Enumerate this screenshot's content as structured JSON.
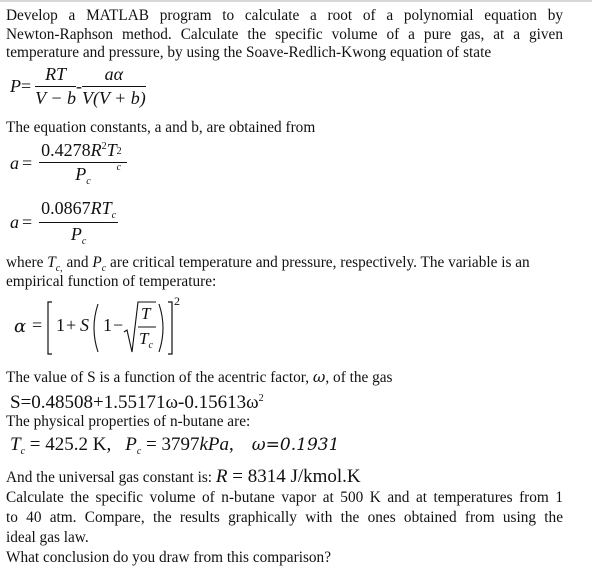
{
  "document": {
    "intro_lines": [
      "Develop a MATLAB program to calculate a root of a polynomial equation by",
      "Newton-Raphson method. Calculate the specific volume of a pure gas, at a given",
      "temperature and pressure, by using the Soave-Redlich-Kwong equation of state"
    ],
    "srk_equation": {
      "lhs": "P",
      "eq": "=",
      "term1_num": "RT",
      "term1_den": "V − b",
      "minus": "-",
      "term2_num": "aα",
      "term2_den": "V(V + b)"
    },
    "constants_intro": "The equation constants, a and b, are obtained from",
    "eq_a": {
      "lhs": "a",
      "eq": "=",
      "num_coef": "0.4278",
      "num_R": "R",
      "num_R_exp": "2",
      "num_T": "T",
      "num_T_sub": "c",
      "num_T_exp": "2",
      "den": "P",
      "den_sub": "c"
    },
    "eq_b": {
      "lhs": "a",
      "eq": "=",
      "num_coef": "0.0867",
      "num_RT": "RT",
      "num_sub": "c",
      "den": "P",
      "den_sub": "c"
    },
    "where_line1": {
      "pre": "where ",
      "tc": "T",
      "tc_sub": "c,",
      "mid": " and ",
      "pc": "P",
      "pc_sub": "c",
      "post": " are critical temperature and pressure, respectively. The variable is an"
    },
    "where_line2": "empirical function of temperature:",
    "alpha_equation": {
      "lhs": "α",
      "eq": "=",
      "one": "1",
      "plus": "+",
      "S": "S",
      "one2": "1",
      "minus": "−",
      "T": "T",
      "Tc": "T",
      "Tc_sub": "c",
      "exp": "2"
    },
    "s_intro_pre": "The value of S is a function of the acentric factor, ",
    "s_intro_omega": "ω",
    "s_intro_post": ", of the gas",
    "s_equation": {
      "text": "S=0.48508+1.55171ω-0.15613ω",
      "exp": "2"
    },
    "properties_intro": "The physical properties of n-butane are:",
    "properties": {
      "tc_sym": "T",
      "tc_sub": "c",
      "tc_val": " = 425.2 K,",
      "pc_sym": "P",
      "pc_sub": "c",
      "pc_val": " = 3797",
      "pc_unit": "kPa",
      "pc_comma": ",",
      "omega": "ω=0.1931"
    },
    "gas_constant": {
      "pre": "And the universal gas constant is: ",
      "sym": "R",
      "val": " = 8314 J/kmol.K"
    },
    "task_lines": [
      "Calculate the specific volume of n-butane vapor at 500 K and at temperatures from 1",
      "to 40 atm. Compare, the results graphically with the ones obtained from using the",
      "ideal gas law."
    ],
    "question": "What conclusion do you draw from this comparison?"
  }
}
